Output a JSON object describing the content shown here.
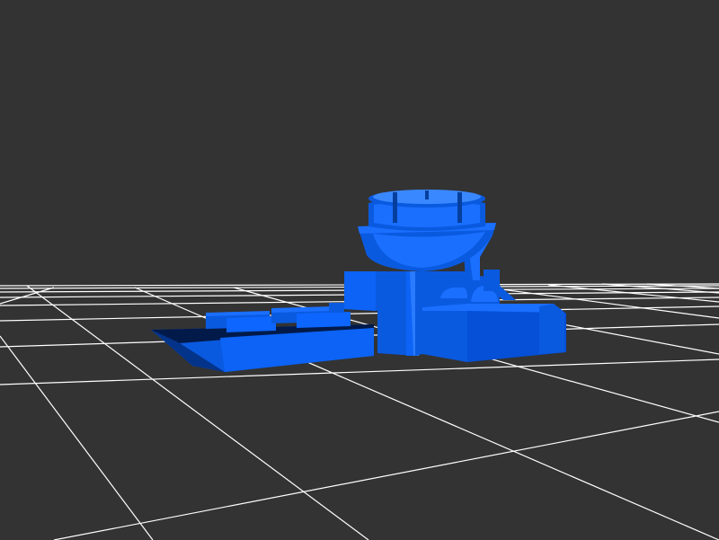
{
  "viewport": {
    "background_color": "#333333",
    "grid_color": "#ffffff",
    "model_color_light": "#1a6fff",
    "model_color_mid": "#0a5ae0",
    "model_color_dark": "#053f9e",
    "model_color_shadow": "#021a4a"
  }
}
